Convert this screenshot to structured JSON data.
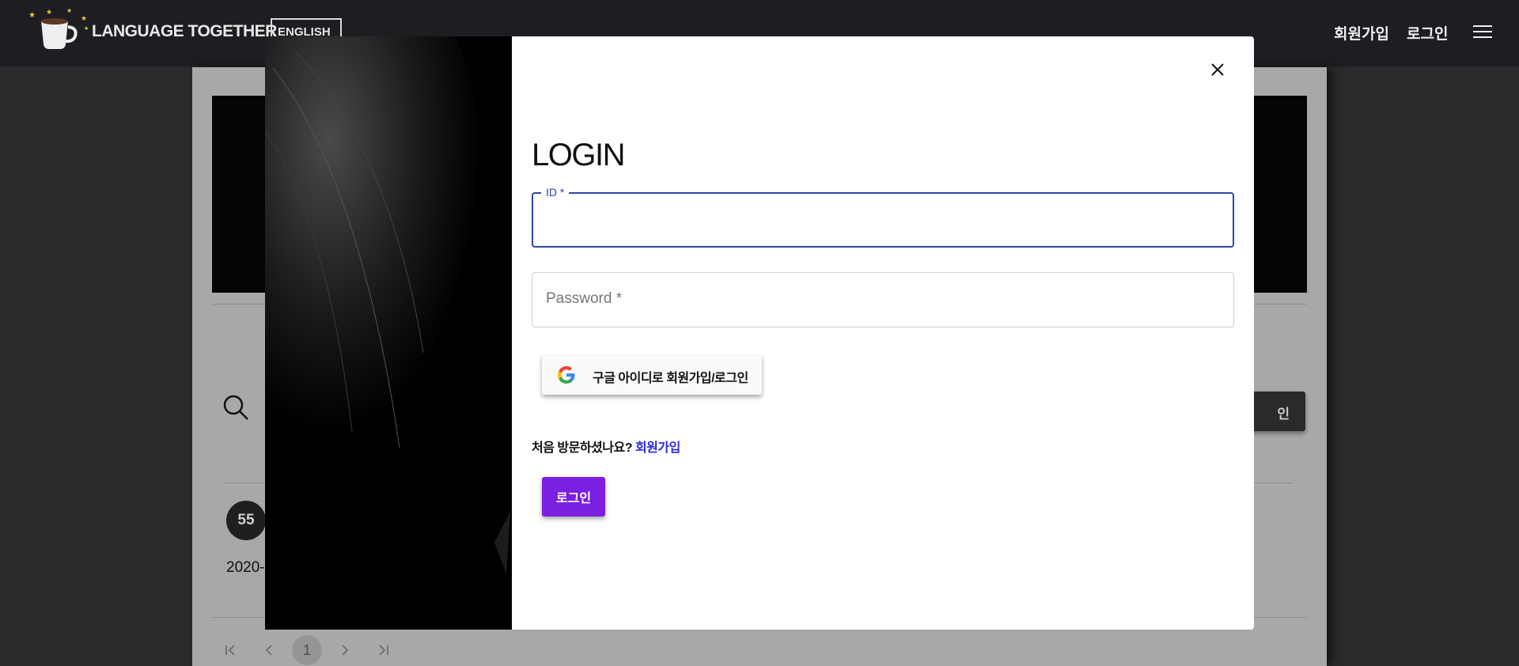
{
  "header": {
    "brand": "LANGUAGE TOGETHER",
    "language": "ENGLISH",
    "signup_label": "회원가입",
    "login_label": "로그인",
    "menu_icon": "hamburger-menu-icon"
  },
  "background_page": {
    "write_button_label": "인",
    "post_number": "55",
    "post_date": "2020-",
    "pagination": {
      "first": "|<",
      "prev": "<",
      "current_page": "1",
      "next": ">",
      "last": ">|"
    }
  },
  "login_modal": {
    "title": "LOGIN",
    "id_field": {
      "label": "ID",
      "value": ""
    },
    "password_field": {
      "placeholder": "Password"
    },
    "google_button_label": "구글 아이디로 회원가입/로그인",
    "first_visit_text": "처음 방문하셨나요?",
    "signup_link_label": "회원가입",
    "login_button_label": "로그인",
    "colors": {
      "accent_purple": "#7b1fe0",
      "focus_blue": "#2f46a8",
      "link_blue": "#2a2ae0"
    }
  }
}
